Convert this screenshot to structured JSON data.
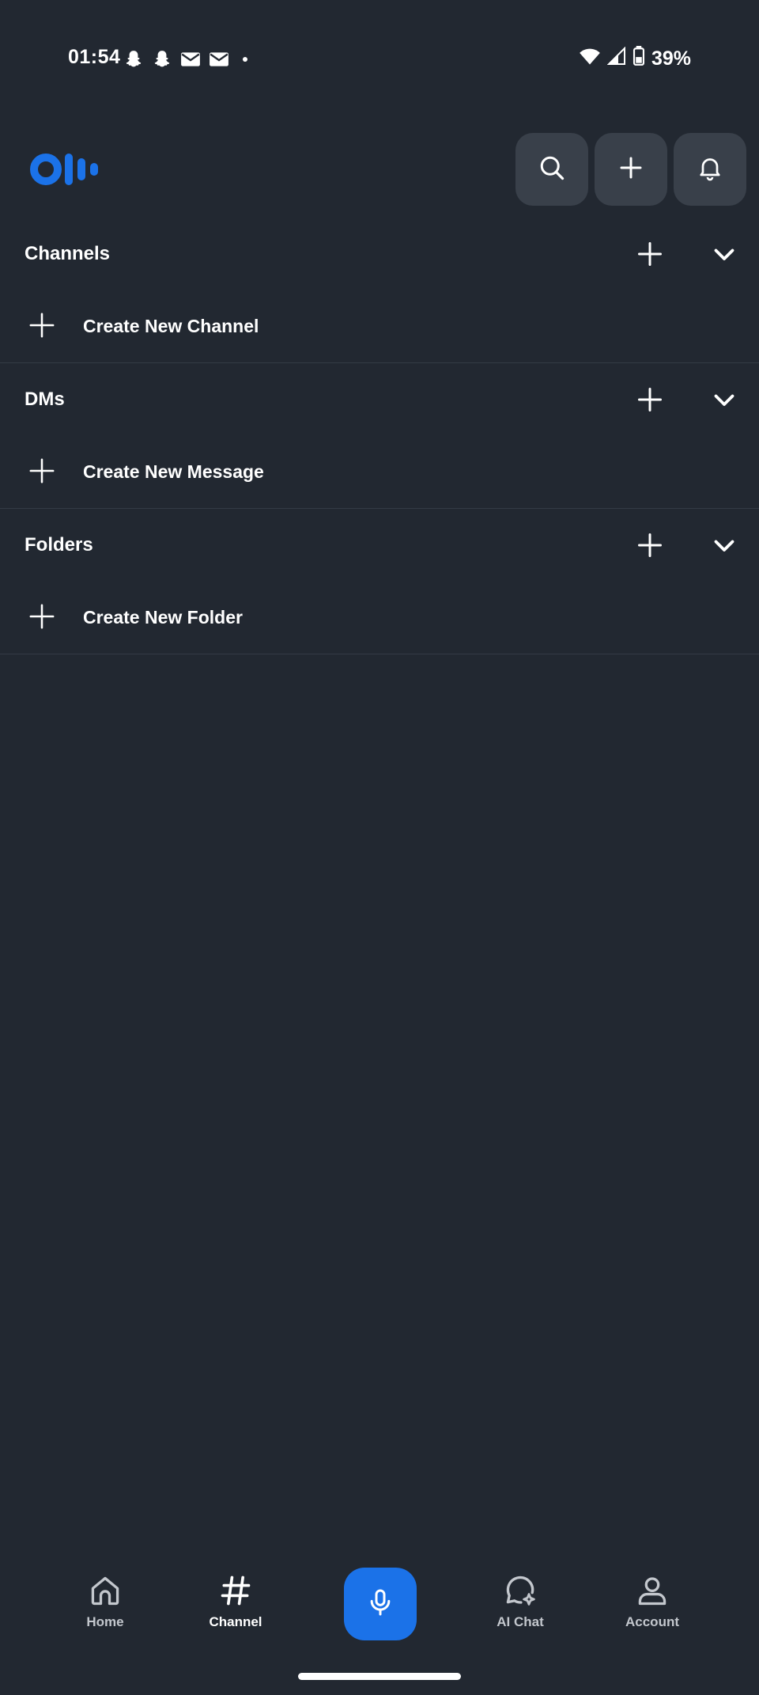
{
  "status_bar": {
    "time": "01:54",
    "battery": "39%",
    "left_icons": [
      "snapchat-icon",
      "snapchat-icon",
      "gmail-icon",
      "gmail-icon",
      "dot-icon"
    ],
    "right_icons": [
      "wifi-icon",
      "signal-icon",
      "battery-icon"
    ]
  },
  "header": {
    "logo": "otter-logo",
    "buttons": [
      "search-icon",
      "plus-icon",
      "bell-icon"
    ]
  },
  "sections": [
    {
      "title": "Channels",
      "create_label": "Create New Channel"
    },
    {
      "title": "DMs",
      "create_label": "Create New Message"
    },
    {
      "title": "Folders",
      "create_label": "Create New Folder"
    }
  ],
  "bottom_nav": {
    "items": [
      {
        "label": "Home",
        "icon": "home-icon"
      },
      {
        "label": "Channel",
        "icon": "hash-icon",
        "active": true
      },
      {
        "label": "AI Chat",
        "icon": "ai-chat-icon"
      },
      {
        "label": "Account",
        "icon": "account-icon"
      }
    ],
    "record_icon": "microphone-icon"
  },
  "colors": {
    "background": "#222831",
    "button_bg": "#39404a",
    "accent": "#1b72e8",
    "divider": "#343b45"
  }
}
